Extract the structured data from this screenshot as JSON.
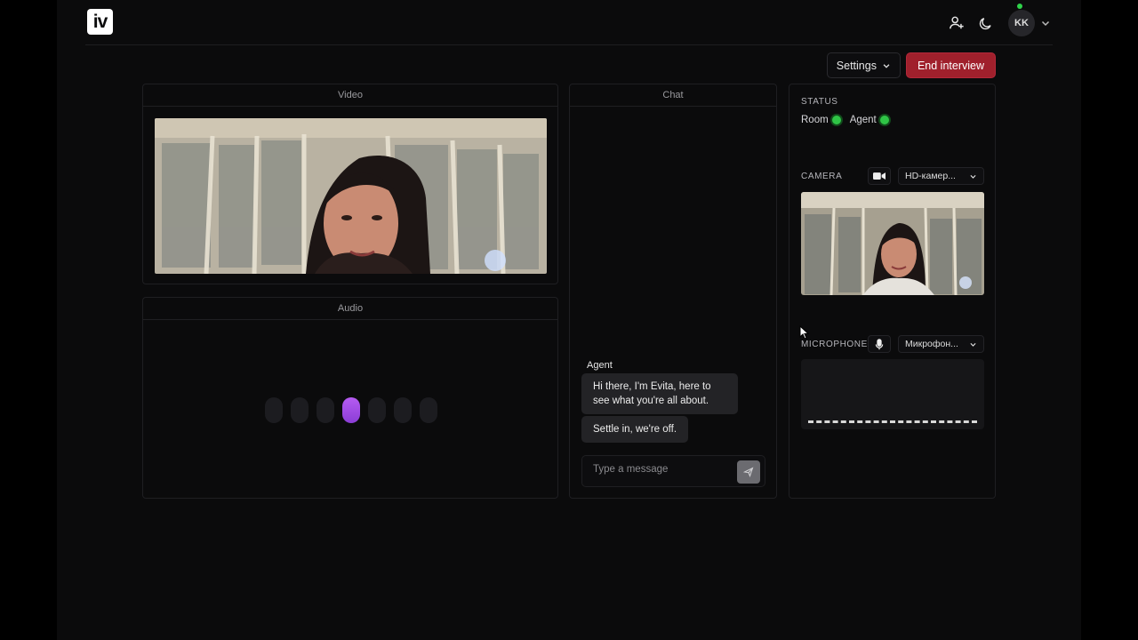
{
  "header": {
    "logo_text": "iv",
    "user_initials": "KK"
  },
  "toolbar": {
    "settings_label": "Settings",
    "end_label": "End interview"
  },
  "video_panel": {
    "title": "Video"
  },
  "audio_panel": {
    "title": "Audio",
    "active_bar_index": 3,
    "bar_count": 7
  },
  "chat_panel": {
    "title": "Chat",
    "messages": [
      {
        "author": "Agent",
        "text": "Hi there, I'm Evita, here to see what you're all about."
      },
      {
        "author": "Agent",
        "text": "Settle in, we're off."
      }
    ],
    "input_placeholder": "Type a message"
  },
  "sidebar": {
    "status_label": "STATUS",
    "status_items": [
      {
        "label": "Room",
        "state": "connected"
      },
      {
        "label": "Agent",
        "state": "connected"
      }
    ],
    "camera_label": "CAMERA",
    "camera_device": "HD-камер...",
    "microphone_label": "MICROPHONE",
    "microphone_device": "Микрофон..."
  },
  "colors": {
    "accent_end": "#a0202c",
    "status_ok": "#2fc446",
    "audio_active": "#a34de6"
  }
}
